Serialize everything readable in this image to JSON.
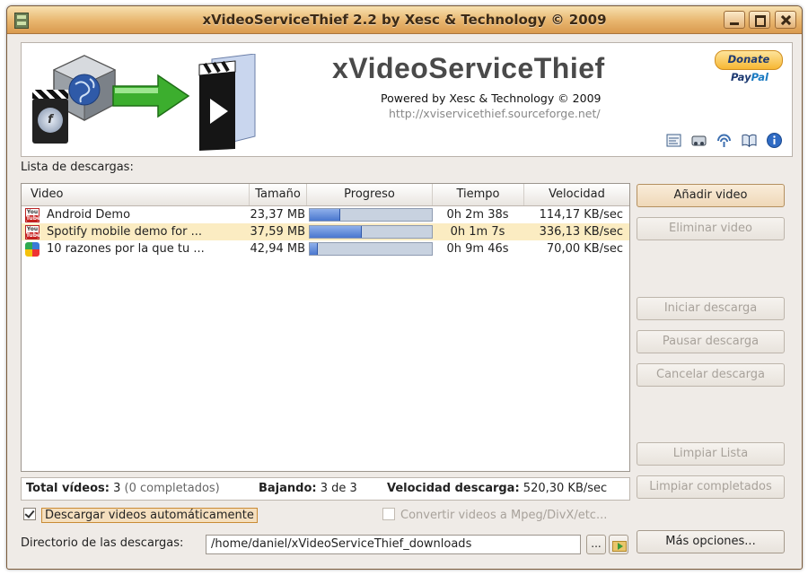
{
  "window": {
    "title": "xVideoServiceThief 2.2 by Xesc & Technology © 2009"
  },
  "banner": {
    "app_title": "xVideoServiceThief",
    "powered": "Powered by Xesc & Technology © 2009",
    "url": "http://xviservicethief.sourceforge.net/",
    "donate_label": "Donate",
    "paypal_label_1": "Pay",
    "paypal_label_2": "Pal",
    "flash_glyph": "f",
    "toolbar_icons": [
      "options-icon",
      "drag-drop-icon",
      "updates-icon",
      "manual-icon",
      "info-icon"
    ]
  },
  "downloads": {
    "label": "Lista de descargas:",
    "columns": {
      "video": "Video",
      "size": "Tamaño",
      "progress": "Progreso",
      "time": "Tiempo",
      "speed": "Velocidad"
    },
    "rows": [
      {
        "icon": "youtube-icon",
        "title": "Android Demo",
        "size": "23,37 MB",
        "progress": 0.24,
        "time": "0h 2m 38s",
        "speed": "114,17 KB/sec",
        "selected": false
      },
      {
        "icon": "youtube-icon",
        "title": "Spotify mobile demo for ...",
        "size": "37,59 MB",
        "progress": 0.42,
        "time": "0h 1m 7s",
        "speed": "336,13 KB/sec",
        "selected": true
      },
      {
        "icon": "google-video-icon",
        "title": "10 razones por la que tu ...",
        "size": "42,94 MB",
        "progress": 0.06,
        "time": "0h 9m 46s",
        "speed": "70,00 KB/sec",
        "selected": false
      }
    ],
    "youtube_badge_top": "You",
    "youtube_badge_bottom": "Tube"
  },
  "buttons": {
    "add": "Añadir video",
    "remove": "Eliminar video",
    "start": "Iniciar descarga",
    "pause": "Pausar descarga",
    "cancel": "Cancelar descarga",
    "clear_list": "Limpiar Lista",
    "clear_completed": "Limpiar completados",
    "more_options": "Más opciones..."
  },
  "status": {
    "total_label": "Total vídeos:",
    "total_value": "3",
    "completed": "(0 completados)",
    "downloading_label": "Bajando:",
    "downloading_value": "3 de 3",
    "speed_label": "Velocidad descarga:",
    "speed_value": "520,30 KB/sec"
  },
  "options": {
    "auto_download_label": "Descargar videos automáticamente",
    "auto_download_checked": true,
    "convert_label": "Convertir videos a Mpeg/DivX/etc...",
    "convert_checked": false
  },
  "directory": {
    "label": "Directorio de las descargas:",
    "value": "/home/daniel/xVideoServiceThief_downloads",
    "browse_label": "..."
  }
}
